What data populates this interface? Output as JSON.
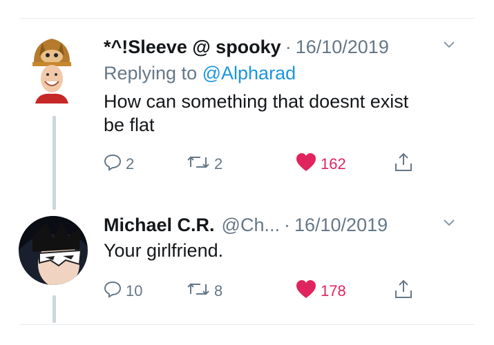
{
  "tweets": [
    {
      "name": "*^!Sleeve @ spooky",
      "handle": "",
      "dot": "·",
      "date": "16/10/2019",
      "replying_prefix": "Replying to",
      "replying_to": "@Alpharad",
      "text": "How can something that doesnt exist be flat",
      "replies": "2",
      "retweets": "2",
      "likes": "162"
    },
    {
      "name": "Michael C.R.",
      "handle": "@Ch...",
      "dot": "·",
      "date": "16/10/2019",
      "text": "Your girlfriend.",
      "replies": "10",
      "retweets": "8",
      "likes": "178"
    }
  ],
  "icons": {
    "reply": "reply-icon",
    "retweet": "retweet-icon",
    "like": "heart-icon",
    "share": "share-icon",
    "chevron": "chevron-down-icon"
  },
  "colors": {
    "like": "#e0245e",
    "link": "#1b95e0",
    "muted": "#657786"
  }
}
